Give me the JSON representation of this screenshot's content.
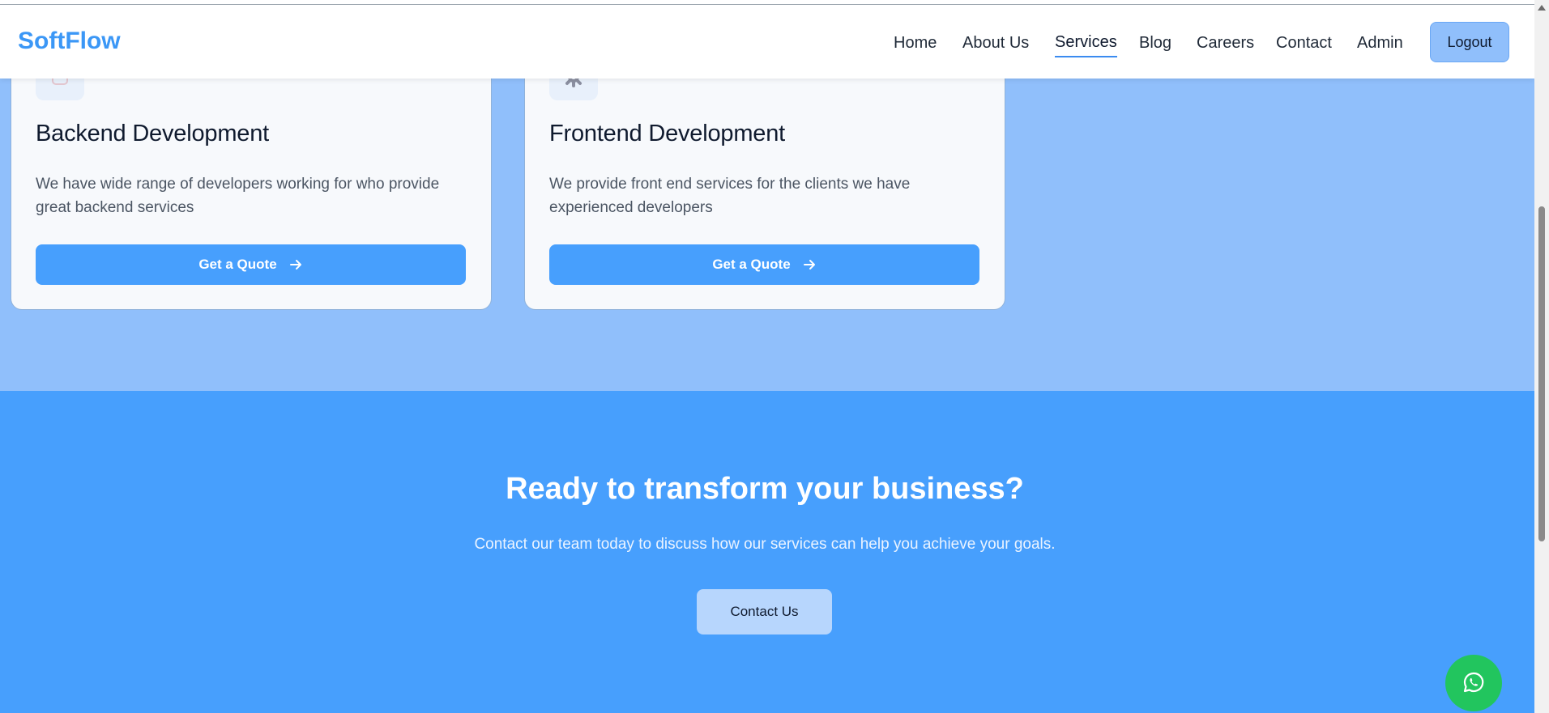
{
  "navbar": {
    "logo": "SoftFlow",
    "items": [
      {
        "label": "Home"
      },
      {
        "label": "About Us"
      },
      {
        "label": "Services",
        "active": true
      },
      {
        "label": "Blog"
      },
      {
        "label": "Careers"
      },
      {
        "label": "Contact"
      },
      {
        "label": "Admin"
      }
    ],
    "logout_label": "Logout"
  },
  "services": {
    "cards": [
      {
        "icon": "code-icon",
        "title": "Backend Development",
        "description": "We have wide range of developers working for who provide great backend services",
        "button_label": "Get a Quote"
      },
      {
        "icon": "gear-icon",
        "title": "Frontend Development",
        "description": "We provide front end services for the clients we have experienced developers",
        "button_label": "Get a Quote"
      }
    ]
  },
  "cta": {
    "title": "Ready to transform your business?",
    "text": "Contact our team today to discuss how our services can help you achieve your goals.",
    "button_label": "Contact Us"
  },
  "floating": {
    "icon": "whatsapp-icon"
  },
  "colors": {
    "brand": "#3b97f6",
    "services_bg": "#90bffb",
    "cta_bg": "#479ffd",
    "button_primary": "#479ffd",
    "whatsapp": "#22c55e"
  }
}
